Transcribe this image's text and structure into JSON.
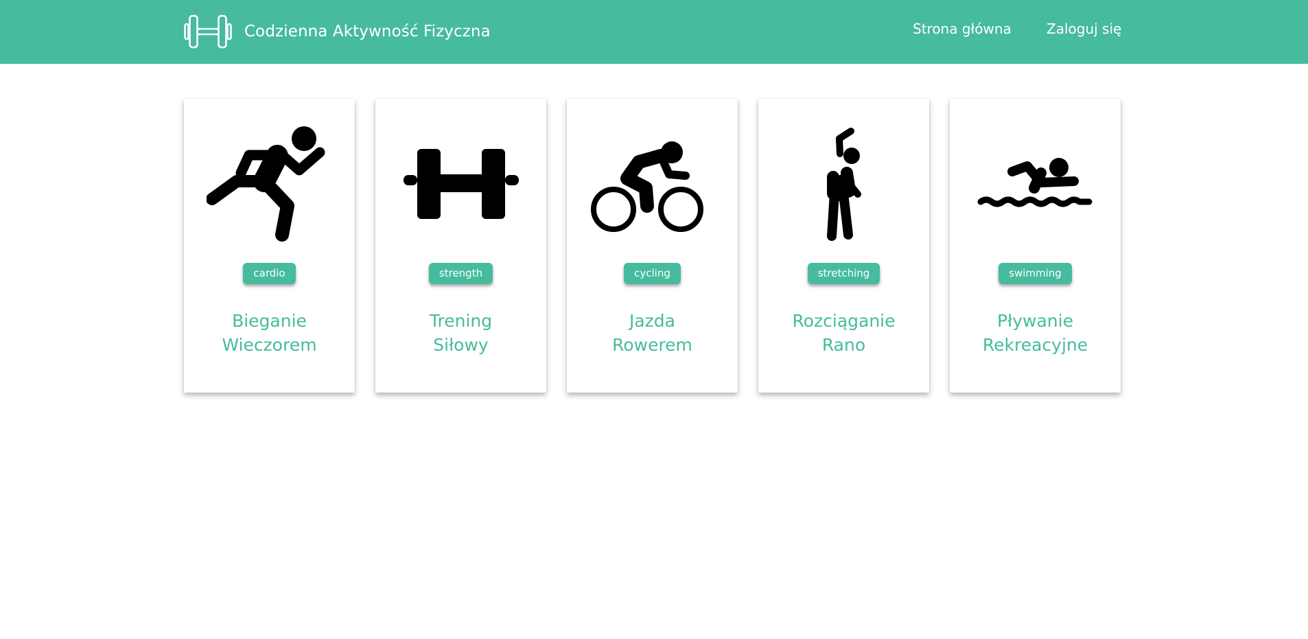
{
  "header": {
    "brand_text": "Codzienna Aktywność Fizyczna",
    "logo_icon": "dumbbell-outline-icon",
    "nav": {
      "home": "Strona główna",
      "login": "Zaloguj się"
    }
  },
  "colors": {
    "accent": "#46bb9e",
    "background": "#ffffff",
    "icon": "#000000"
  },
  "activities": [
    {
      "icon": "running-icon",
      "badge": "cardio",
      "title_line1": "Bieganie",
      "title_line2": "Wieczorem"
    },
    {
      "icon": "dumbbell-icon",
      "badge": "strength",
      "title_line1": "Trening",
      "title_line2": "Siłowy"
    },
    {
      "icon": "cycling-icon",
      "badge": "cycling",
      "title_line1": "Jazda",
      "title_line2": "Rowerem"
    },
    {
      "icon": "stretching-icon",
      "badge": "stretching",
      "title_line1": "Rozciąganie",
      "title_line2": "Rano"
    },
    {
      "icon": "swimming-icon",
      "badge": "swimming",
      "title_line1": "Pływanie",
      "title_line2": "Rekreacyjne"
    }
  ]
}
